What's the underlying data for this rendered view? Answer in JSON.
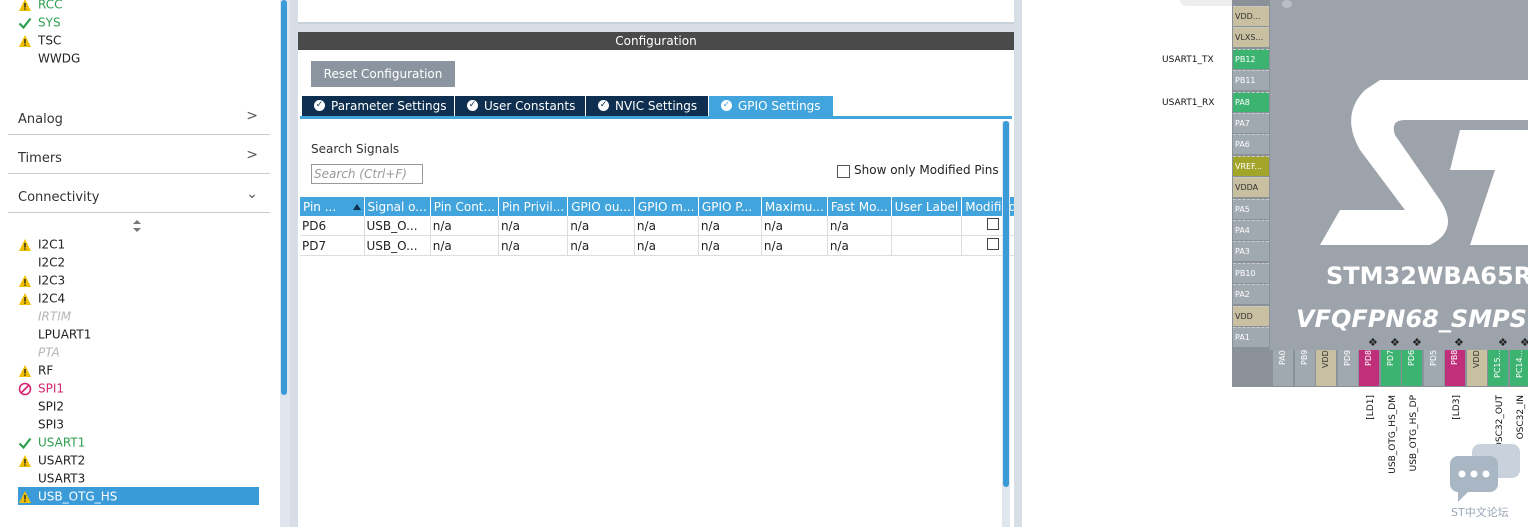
{
  "left_panel": {
    "top_items": [
      {
        "label": "RCC",
        "status": "warning",
        "style": "green"
      },
      {
        "label": "SYS",
        "status": "ok",
        "style": "green"
      },
      {
        "label": "TSC",
        "status": "warning",
        "style": "normal"
      },
      {
        "label": "WWDG",
        "status": "none",
        "style": "normal"
      }
    ],
    "categories": [
      {
        "label": "Analog",
        "chevron": ">"
      },
      {
        "label": "Timers",
        "chevron": ">"
      },
      {
        "label": "Connectivity",
        "chevron": "v"
      }
    ],
    "connectivity_items": [
      {
        "label": "I2C1",
        "status": "warning",
        "style": "normal"
      },
      {
        "label": "I2C2",
        "status": "none",
        "style": "normal"
      },
      {
        "label": "I2C3",
        "status": "warning",
        "style": "normal"
      },
      {
        "label": "I2C4",
        "status": "warning",
        "style": "normal"
      },
      {
        "label": "IRTIM",
        "status": "none",
        "style": "disabled"
      },
      {
        "label": "LPUART1",
        "status": "none",
        "style": "normal"
      },
      {
        "label": "PTA",
        "status": "none",
        "style": "disabled"
      },
      {
        "label": "RF",
        "status": "warning",
        "style": "normal"
      },
      {
        "label": "SPI1",
        "status": "blocked",
        "style": "magenta"
      },
      {
        "label": "SPI2",
        "status": "none",
        "style": "normal"
      },
      {
        "label": "SPI3",
        "status": "none",
        "style": "normal"
      },
      {
        "label": "USART1",
        "status": "ok",
        "style": "green"
      },
      {
        "label": "USART2",
        "status": "warning",
        "style": "normal"
      },
      {
        "label": "USART3",
        "status": "none",
        "style": "normal"
      },
      {
        "label": "USB_OTG_HS",
        "status": "warning",
        "style": "selected"
      }
    ],
    "sort_icon": "sort-arrows-icon"
  },
  "config": {
    "header": "Configuration",
    "reset_button": "Reset Configuration",
    "tabs": [
      {
        "label": "Parameter Settings",
        "active": false
      },
      {
        "label": "User Constants",
        "active": false
      },
      {
        "label": "NVIC Settings",
        "active": false
      },
      {
        "label": "GPIO Settings",
        "active": true
      }
    ],
    "search_label": "Search Signals",
    "search_placeholder": "Search (Ctrl+F)",
    "show_modified_label": "Show only Modified Pins",
    "table": {
      "headers": [
        "Pin ...",
        "Signal o...",
        "Pin Cont...",
        "Pin Privil...",
        "GPIO ou...",
        "GPIO m...",
        "GPIO P...",
        "Maximu...",
        "Fast Mo...",
        "User Label",
        "Modified"
      ],
      "rows": [
        [
          "PD6",
          "USB_O...",
          "n/a",
          "n/a",
          "n/a",
          "n/a",
          "n/a",
          "n/a",
          "n/a",
          "",
          ""
        ],
        [
          "PD7",
          "USB_O...",
          "n/a",
          "n/a",
          "n/a",
          "n/a",
          "n/a",
          "n/a",
          "n/a",
          "",
          ""
        ]
      ]
    }
  },
  "chip": {
    "name": "STM32WBA65R",
    "package": "VFQFPN68_SMPS",
    "left_pins": [
      "VDD...",
      "VLXS...",
      "PB12",
      "PB11",
      "PA8",
      "PA7",
      "PA6",
      "VREF...",
      "VDDA",
      "PA5",
      "PA4",
      "PA3",
      "PB10",
      "PA2",
      "VDD",
      "PA1"
    ],
    "signal_labels": {
      "tx": "USART1_TX",
      "rx": "USART1_RX"
    },
    "bottom_pins": [
      "PA0",
      "PB9",
      "VDD",
      "PD9",
      "PD8",
      "PD7",
      "PD6",
      "PD5",
      "PB8",
      "VDD",
      "PC15...",
      "PC14..."
    ],
    "bottom_labels": {
      "ld1": "[LD1]",
      "dm": "USB_OTG_HS_DM",
      "dp": "USB_OTG_HS_DP",
      "ld3": "[LD3]",
      "osc_out": "OSC32_OUT",
      "osc_in": "OSC32_IN"
    },
    "watermark": "ST中文论坛"
  },
  "colors": {
    "accent": "#41a4dc",
    "tab_dark": "#0e2f4f",
    "ok": "#2e9e4f",
    "warning": "#f0c000",
    "blocked": "#d6246e",
    "pin_green": "#3cb371",
    "pin_magenta": "#c0307a"
  }
}
